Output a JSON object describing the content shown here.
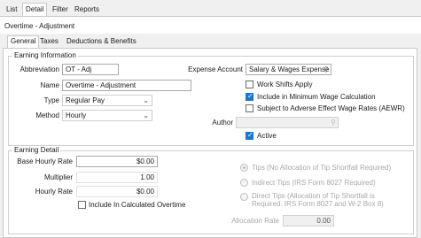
{
  "top_tabs": [
    "List",
    "Detail",
    "Filter",
    "Reports"
  ],
  "record_title": "Overtime - Adjustment",
  "sub_tabs": [
    "General",
    "Taxes",
    "Deductions & Benefits"
  ],
  "earning_info": {
    "section_label": "Earning Information",
    "abbreviation_label": "Abbreviation",
    "abbreviation_value": "OT - Adj",
    "name_label": "Name",
    "name_value": "Overtime - Adjustment",
    "type_label": "Type",
    "type_value": "Regular Pay",
    "method_label": "Method",
    "method_value": "Hourly",
    "expense_account_label": "Expense Account",
    "expense_account_value": "Salary & Wages Expense",
    "work_shifts_label": "Work Shifts Apply",
    "work_shifts_checked": false,
    "min_wage_label": "Include in Minimum Wage Calculation",
    "min_wage_checked": true,
    "aewr_label": "Subject to Adverse Effect Wage Rates (AEWR)",
    "aewr_checked": false,
    "author_label": "Author",
    "author_value": "",
    "active_label": "Active",
    "active_checked": true
  },
  "earning_detail": {
    "section_label": "Earning Detail",
    "base_rate_label": "Base Hourly Rate",
    "base_rate_value": "$0.00",
    "multiplier_label": "Multiplier",
    "multiplier_value": "1.00",
    "hourly_rate_label": "Hourly Rate",
    "hourly_rate_value": "$0.00",
    "include_ot_label": "Include In Calculated Overtime",
    "include_ot_checked": false,
    "tips_label": "Tips (No Allocation of Tip Shortfall Required)",
    "indirect_tips_label": "Indirect Tips (IRS Form 8027 Required)",
    "direct_tips_line1": "Direct Tips (Allocation of Tip Shortfall is",
    "direct_tips_line2": "Required. IRS Form 8027 and W-2 Box 8)",
    "allocation_rate_label": "Allocation Rate",
    "allocation_rate_value": "0.00"
  },
  "icons": {
    "lookup": "magnifier-icon",
    "dropdown": "chevron-down-icon"
  },
  "colors": {
    "accent": "#1976d2",
    "panel_bg": "#ffffff",
    "app_bg": "#f0f0f0"
  }
}
